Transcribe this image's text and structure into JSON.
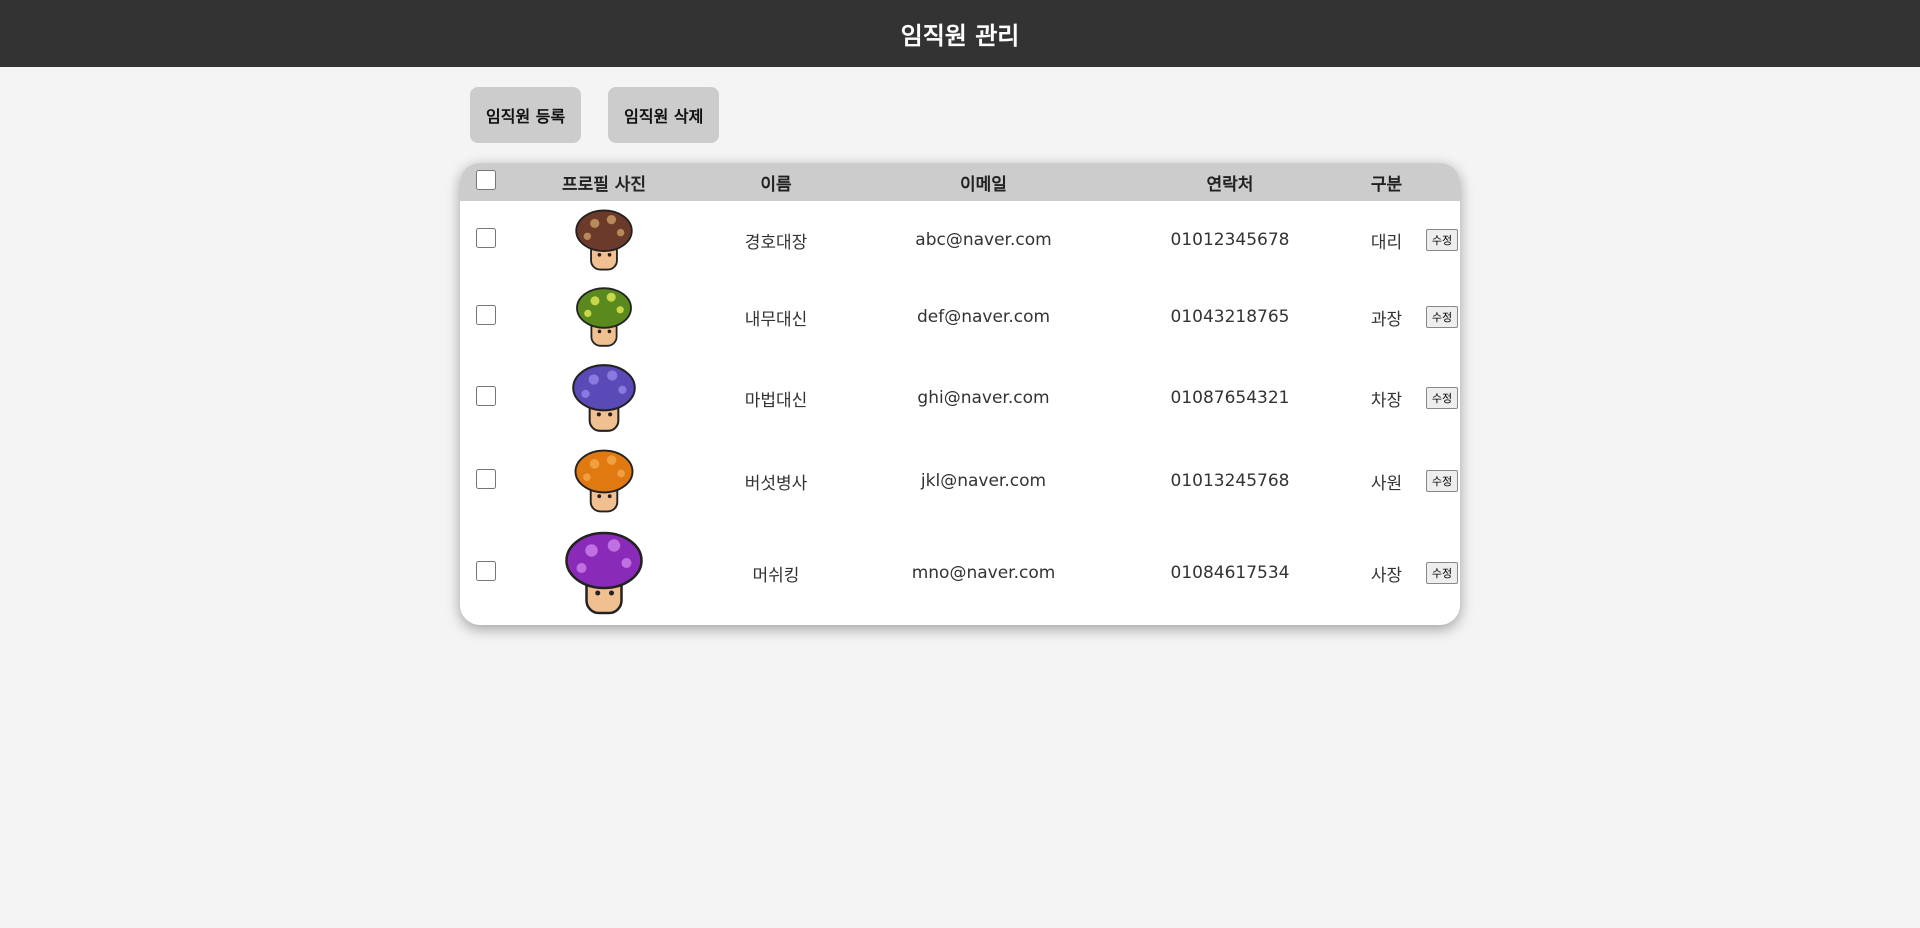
{
  "header": {
    "title": "임직원 관리"
  },
  "toolbar": {
    "register_label": "임직원 등록",
    "delete_label": "임직원 삭제"
  },
  "table": {
    "columns": [
      "프로필 사진",
      "이름",
      "이메일",
      "연락처",
      "구분"
    ],
    "edit_label": "수정",
    "rows": [
      {
        "name": "경호대장",
        "email": "abc@naver.com",
        "phone": "01012345678",
        "rank": "대리",
        "cap": "#6b3a2a",
        "spot": "#b88a5a"
      },
      {
        "name": "내무대신",
        "email": "def@naver.com",
        "phone": "01043218765",
        "rank": "과장",
        "cap": "#5a8a1e",
        "spot": "#c8d84a"
      },
      {
        "name": "마법대신",
        "email": "ghi@naver.com",
        "phone": "01087654321",
        "rank": "차장",
        "cap": "#5a4ab8",
        "spot": "#8a7ae0"
      },
      {
        "name": "버섯병사",
        "email": "jkl@naver.com",
        "phone": "01013245768",
        "rank": "사원",
        "cap": "#e07a10",
        "spot": "#f0a040"
      },
      {
        "name": "머쉬킹",
        "email": "mno@naver.com",
        "phone": "01084617534",
        "rank": "사장",
        "cap": "#8a2ab8",
        "spot": "#c070e0"
      }
    ]
  }
}
